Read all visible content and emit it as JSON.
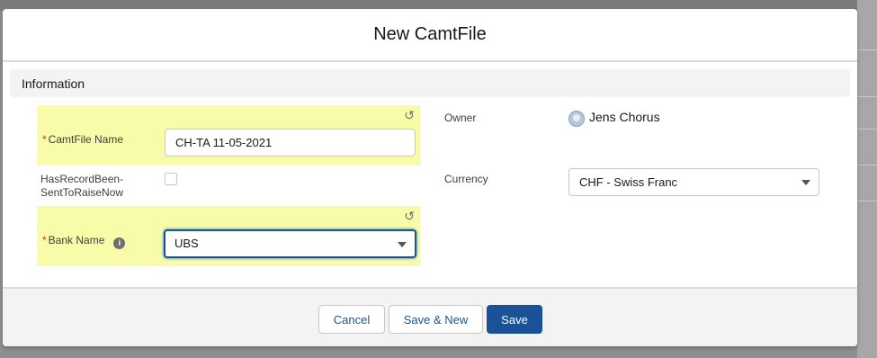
{
  "modal": {
    "title": "New CamtFile",
    "section_title": "Information",
    "undo_icon": "undo-icon"
  },
  "fields": {
    "camtfile_name": {
      "required_mark": "*",
      "label": "CamtFile Name",
      "value": "CH-TA 11-05-2021"
    },
    "has_record": {
      "label_line1": "HasRecordBeen-",
      "label_line2": "SentToRaiseNow",
      "checked": false
    },
    "bank_name": {
      "required_mark": "*",
      "label": "Bank Name",
      "value": "UBS",
      "info_icon": "i"
    },
    "owner": {
      "label": "Owner",
      "value": "Jens Chorus"
    },
    "currency": {
      "label": "Currency",
      "value": "CHF - Swiss Franc"
    }
  },
  "footer": {
    "cancel": "Cancel",
    "save_new": "Save & New",
    "save": "Save"
  },
  "colors": {
    "highlight": "#f8fba8",
    "brand": "#1b5297",
    "required": "#c23934"
  }
}
